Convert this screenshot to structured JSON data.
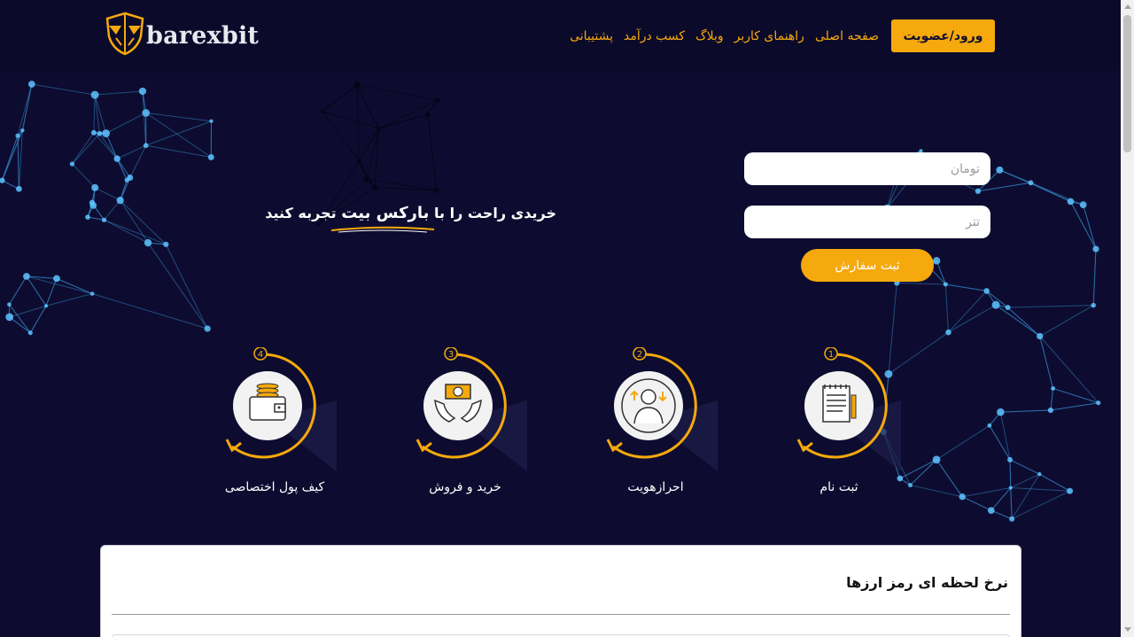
{
  "header": {
    "logo_text": "barexbit",
    "login_label": "ورود/عضویت",
    "nav": [
      {
        "label": "صفحه اصلی"
      },
      {
        "label": "راهنمای کاربر"
      },
      {
        "label": "وبلاگ"
      },
      {
        "label": "کسب درآمد"
      },
      {
        "label": "پشتیبانی"
      }
    ]
  },
  "hero": {
    "tagline_before": "خریدی راحت را با ",
    "tagline_brand": "بارکس بیت",
    "tagline_after": " تجربه کنید",
    "toman_placeholder": "تومان",
    "tether_placeholder": "تتر",
    "order_button": "ثبت سفارش"
  },
  "steps": [
    {
      "number": "1",
      "label": "ثبت نام",
      "icon": "notepad-icon"
    },
    {
      "number": "2",
      "label": "احرازهویت",
      "icon": "user-verification-icon"
    },
    {
      "number": "3",
      "label": "خرید و فروش",
      "icon": "money-hands-icon"
    },
    {
      "number": "4",
      "label": "کیف پول اختصاصی",
      "icon": "wallet-icon"
    }
  ],
  "rates": {
    "title": "نرخ لحظه ای رمز ارزها"
  },
  "colors": {
    "background": "#0d0c30",
    "accent": "#f6a90c",
    "network": "#3a9ce0"
  }
}
